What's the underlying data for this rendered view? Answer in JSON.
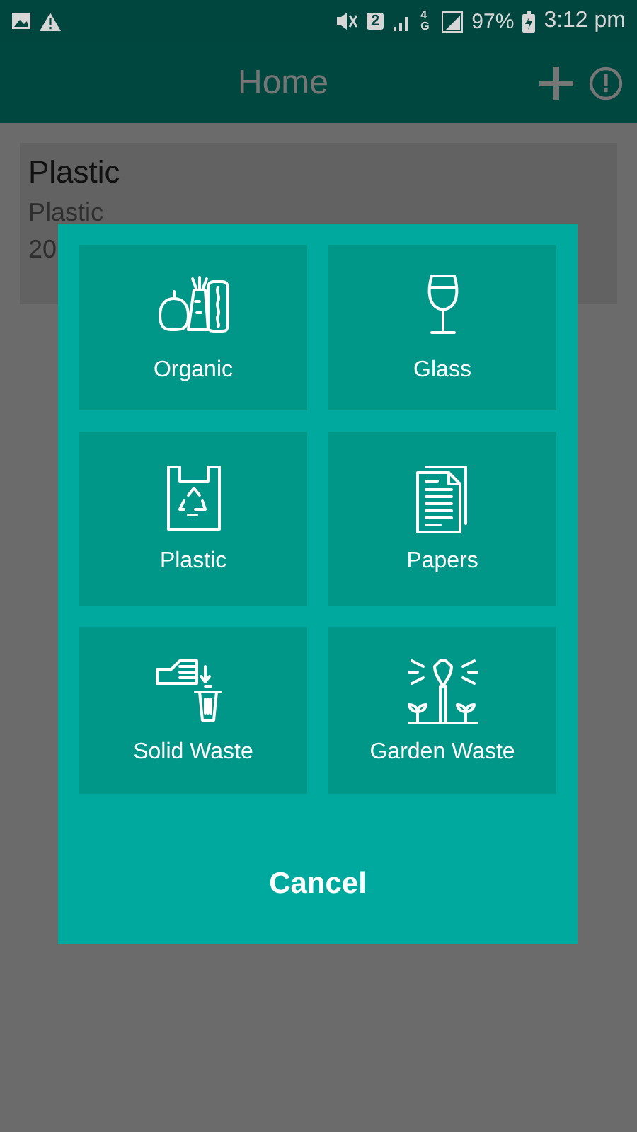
{
  "status_bar": {
    "sim": "2",
    "network": "4G",
    "battery": "97%",
    "time": "3:12 pm"
  },
  "app_bar": {
    "title": "Home"
  },
  "card": {
    "title": "Plastic",
    "subtitle": "Plastic",
    "date": "20"
  },
  "dialog": {
    "options": [
      {
        "label": "Organic",
        "kind": "organic"
      },
      {
        "label": "Glass",
        "kind": "glass"
      },
      {
        "label": "Plastic",
        "kind": "plastic"
      },
      {
        "label": "Papers",
        "kind": "papers"
      },
      {
        "label": "Solid Waste",
        "kind": "solid"
      },
      {
        "label": "Garden Waste",
        "kind": "garden"
      }
    ],
    "cancel": "Cancel"
  }
}
